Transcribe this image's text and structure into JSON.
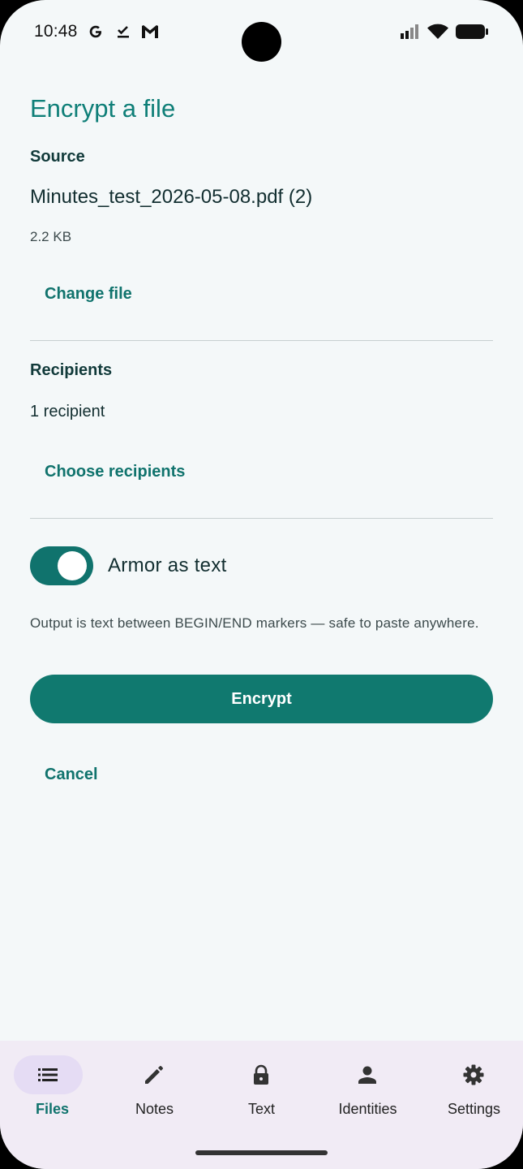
{
  "status": {
    "time": "10:48",
    "notification_icons": [
      "google-icon",
      "check-icon",
      "gmail-icon"
    ],
    "system_icons": [
      "signal-icon",
      "wifi-icon",
      "battery-icon"
    ]
  },
  "page": {
    "title": "Encrypt a file",
    "source": {
      "label": "Source",
      "file_name": "Minutes_test_2026-05-08.pdf (2)",
      "file_size": "2.2 KB",
      "change_label": "Change file"
    },
    "recipients": {
      "label": "Recipients",
      "count_text": "1 recipient",
      "choose_label": "Choose recipients"
    },
    "armor": {
      "label": "Armor as text",
      "enabled": true,
      "helper": "Output is text between BEGIN/END markers — safe to paste anywhere."
    },
    "encrypt_label": "Encrypt",
    "cancel_label": "Cancel"
  },
  "nav": {
    "items": [
      {
        "label": "Files",
        "icon": "list-icon",
        "active": true
      },
      {
        "label": "Notes",
        "icon": "pencil-icon",
        "active": false
      },
      {
        "label": "Text",
        "icon": "lock-icon",
        "active": false
      },
      {
        "label": "Identities",
        "icon": "person-icon",
        "active": false
      },
      {
        "label": "Settings",
        "icon": "gear-icon",
        "active": false
      }
    ]
  },
  "colors": {
    "accent": "#10736d",
    "background": "#f4f8f9",
    "nav_background": "#f1ebf5",
    "nav_active_pill": "#e5dcf4"
  }
}
